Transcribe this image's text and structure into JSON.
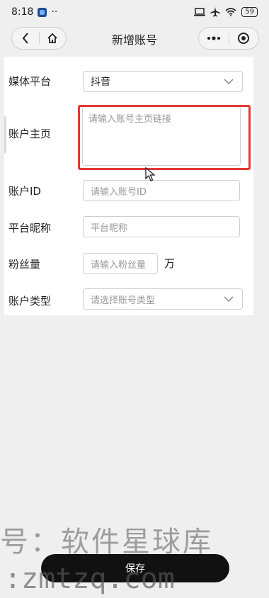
{
  "status": {
    "time": "8:18",
    "dots": "··",
    "battery": "59"
  },
  "nav": {
    "title": "新增账号"
  },
  "form": {
    "platform": {
      "label": "媒体平台",
      "value": "抖音"
    },
    "homepage": {
      "label": "账户主页",
      "placeholder": "请输入账号主页链接"
    },
    "account_id": {
      "label": "账户ID",
      "placeholder": "请输入账号ID"
    },
    "nickname": {
      "label": "平台昵称",
      "placeholder": "平台昵称"
    },
    "followers": {
      "label": "粉丝量",
      "placeholder": "请输入粉丝量",
      "unit": "万"
    },
    "account_type": {
      "label": "账户类型",
      "placeholder": "请选择账号类型"
    }
  },
  "footer": {
    "save_label": "保存"
  },
  "watermark": {
    "line1": "号：软件星球库",
    "line2": ":zmtzq.com"
  },
  "colors": {
    "accent": "#e53935",
    "button_bg": "#111111"
  }
}
